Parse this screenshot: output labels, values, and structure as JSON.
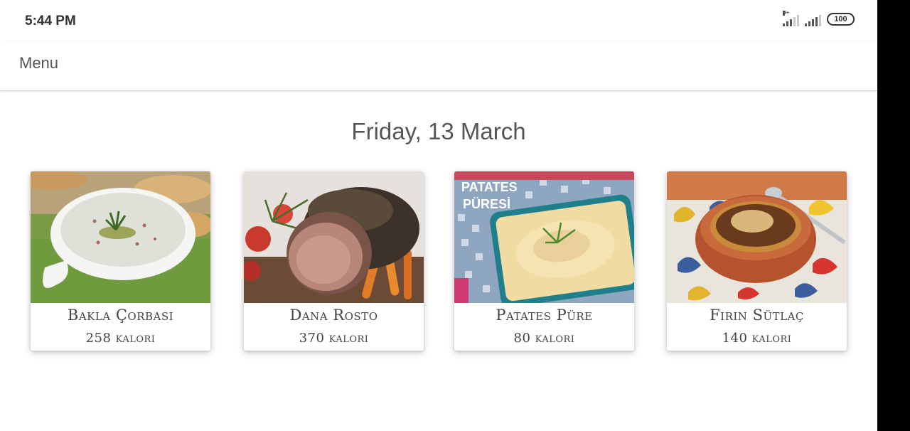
{
  "status_bar": {
    "time": "5:44 PM",
    "network_type": "H+",
    "battery": "100"
  },
  "app_bar": {
    "title": "Menu"
  },
  "date": "Friday, 13 March",
  "meals": [
    {
      "name": "Bakla Çorbası",
      "calories": "258 kalori",
      "image_icon": "bean-soup-photo"
    },
    {
      "name": "Dana Rosto",
      "calories": "370 kalori",
      "image_icon": "roast-beef-photo"
    },
    {
      "name": "Patates Püre",
      "calories": "80 kalori",
      "image_icon": "mashed-potato-photo",
      "image_text": [
        "PATATES",
        "PÜRESİ"
      ]
    },
    {
      "name": "Fırın Sütlaç",
      "calories": "140 kalori",
      "image_icon": "rice-pudding-photo"
    }
  ]
}
